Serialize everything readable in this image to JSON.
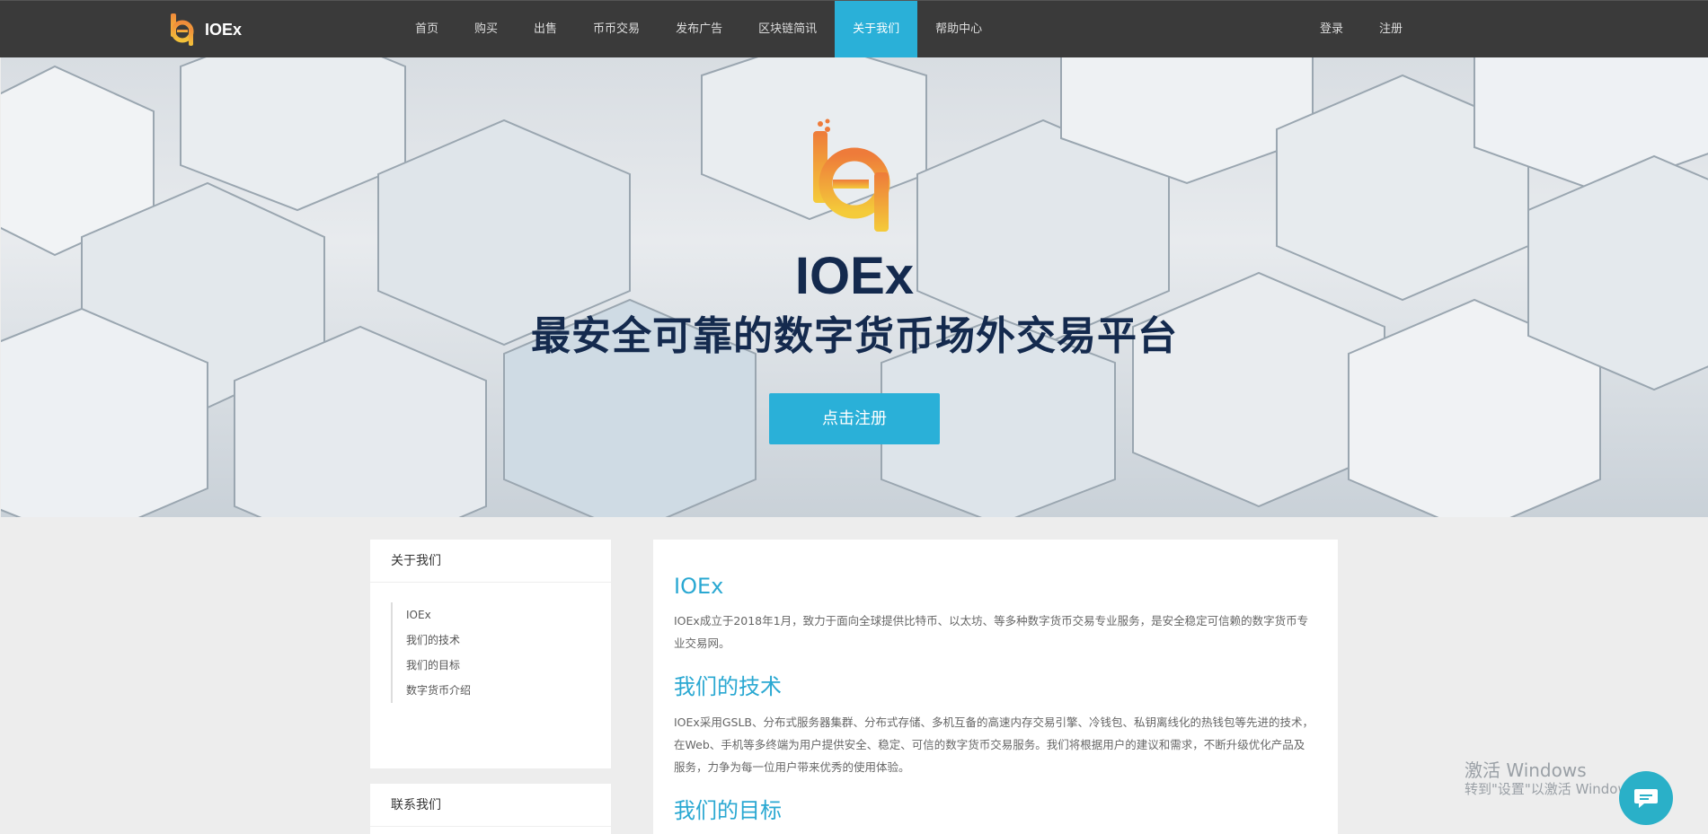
{
  "header": {
    "brand": "IOEx",
    "nav": [
      "首页",
      "购买",
      "出售",
      "币币交易",
      "发布广告",
      "区块链简讯",
      "关于我们",
      "帮助中心"
    ],
    "active_nav": "关于我们",
    "login": "登录",
    "register": "注册"
  },
  "hero": {
    "title": "IOEx",
    "subtitle": "最安全可靠的数字货币场外交易平台",
    "cta": "点击注册"
  },
  "sidebar": {
    "about_title": "关于我们",
    "links": [
      "IOEx",
      "我们的技术",
      "我们的目标",
      "数字货币介绍"
    ],
    "contact_title": "联系我们"
  },
  "content": {
    "sections": [
      {
        "title": "IOEx",
        "body": "IOEx成立于2018年1月，致力于面向全球提供比特币、以太坊、等多种数字货币交易专业服务，是安全稳定可信赖的数字货币专业交易网。"
      },
      {
        "title": "我们的技术",
        "body": "IOEx采用GSLB、分布式服务器集群、分布式存储、多机互备的高速内存交易引擎、冷钱包、私钥离线化的热钱包等先进的技术，在Web、手机等多终端为用户提供安全、稳定、可信的数字货币交易服务。我们将根据用户的建议和需求，不断升级优化产品及服务，力争为每一位用户带来优秀的使用体验。"
      },
      {
        "title": "我们的目标",
        "body": ""
      }
    ]
  },
  "watermark": {
    "line1": "激活 Windows",
    "line2": "转到\"设置\"以激活 Windows。"
  },
  "colors": {
    "accent": "#2ab0d8",
    "nav_bg": "#3a3a3a",
    "hero_text": "#142a4e",
    "logo_orange": "#f0a53a"
  },
  "icons": {
    "brand": "ioex-logo-icon",
    "chat": "chat-bubble-icon"
  }
}
